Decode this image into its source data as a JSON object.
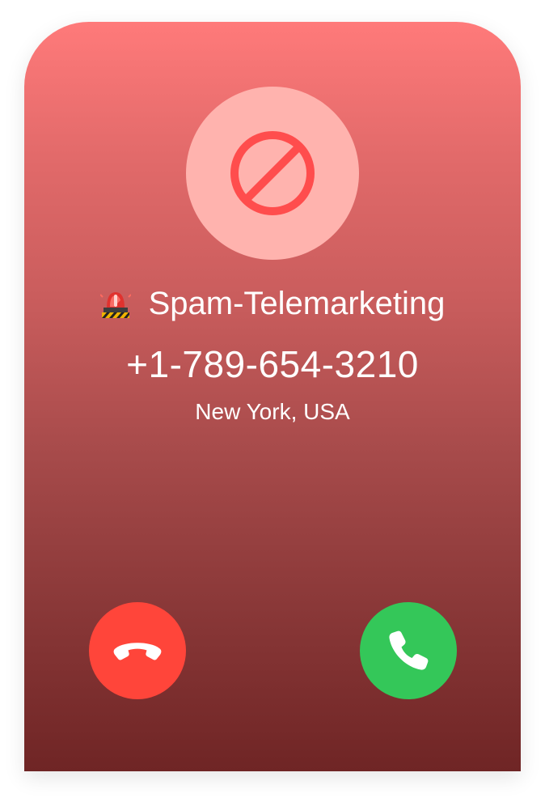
{
  "call": {
    "caller_label": "Spam-Telemarketing",
    "phone_number": "+1-789-654-3210",
    "location": "New York, USA"
  },
  "icons": {
    "status": "block-icon",
    "caller_badge": "siren-icon",
    "decline": "phone-hangup-icon",
    "accept": "phone-icon"
  },
  "colors": {
    "gradient_top": "#ff7a7a",
    "gradient_bottom": "#6f2525",
    "block_badge_bg": "#ffb3ae",
    "block_icon": "#ff4d4d",
    "decline": "#ff453a",
    "accept": "#34c759"
  }
}
